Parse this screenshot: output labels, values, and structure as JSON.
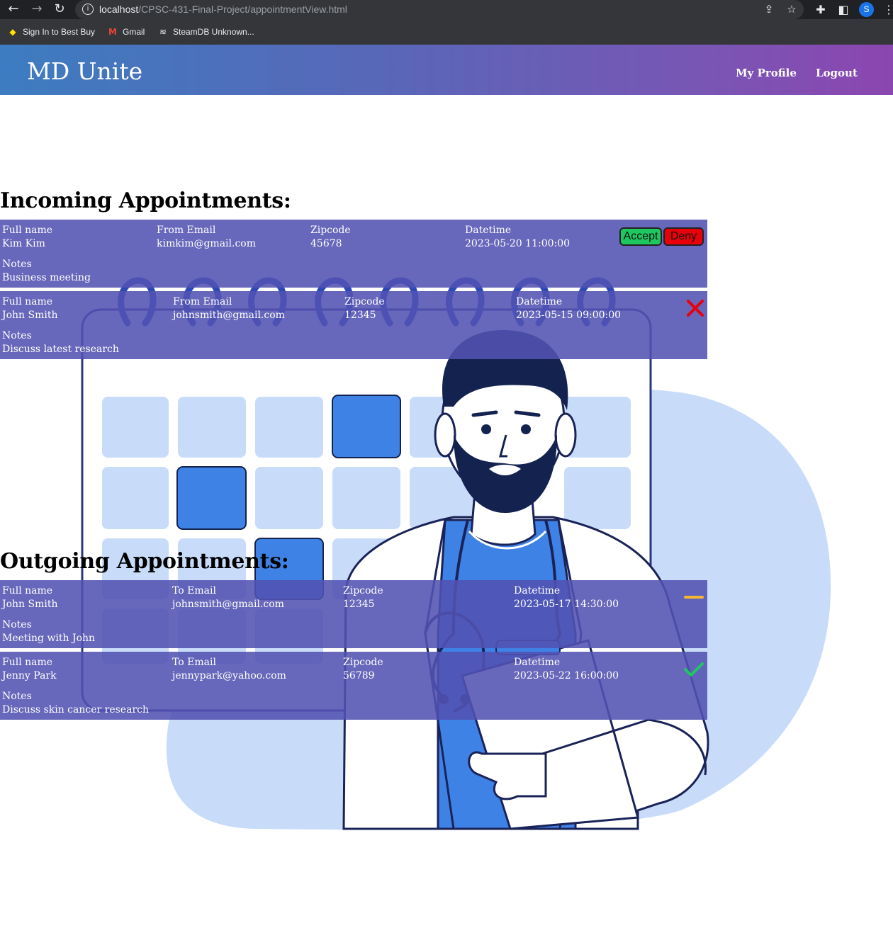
{
  "browser": {
    "url_host": "localhost",
    "url_path": "/CPSC-431-Final-Project/appointmentView.html",
    "profile_initial": "S",
    "bookmarks": [
      {
        "label": "Sign In to Best Buy",
        "icon": "tag-icon"
      },
      {
        "label": "Gmail",
        "icon": "gmail-icon"
      },
      {
        "label": "SteamDB Unknown...",
        "icon": "database-icon"
      }
    ]
  },
  "header": {
    "brand": "MD Unite",
    "nav": [
      {
        "label": "My Profile"
      },
      {
        "label": "Logout"
      }
    ]
  },
  "incoming": {
    "title": "Incoming Appointments:",
    "appointments": [
      {
        "labels": {
          "name": "Full name",
          "email": "From Email",
          "zip": "Zipcode",
          "datetime": "Datetime",
          "notes": "Notes"
        },
        "name": "Kim Kim",
        "email": "kimkim@gmail.com",
        "zip": "45678",
        "datetime": "2023-05-20 11:00:00",
        "notes": "Business meeting",
        "actions": {
          "accept": "Accept",
          "deny": "Deny"
        }
      },
      {
        "labels": {
          "name": "Full name",
          "email": "From Email",
          "zip": "Zipcode",
          "datetime": "Datetime",
          "notes": "Notes"
        },
        "name": "John Smith",
        "email": "johnsmith@gmail.com",
        "zip": "12345",
        "datetime": "2023-05-15 09:00:00",
        "notes": "Discuss latest research",
        "status": "denied",
        "status_color": "#e8000b"
      }
    ]
  },
  "outgoing": {
    "title": "Outgoing Appointments:",
    "appointments": [
      {
        "labels": {
          "name": "Full name",
          "email": "To Email",
          "zip": "Zipcode",
          "datetime": "Datetime",
          "notes": "Notes"
        },
        "name": "John Smith",
        "email": "johnsmith@gmail.com",
        "zip": "12345",
        "datetime": "2023-05-17 14:30:00",
        "notes": "Meeting with John",
        "status": "pending",
        "status_color": "#f5b731"
      },
      {
        "labels": {
          "name": "Full name",
          "email": "To Email",
          "zip": "Zipcode",
          "datetime": "Datetime",
          "notes": "Notes"
        },
        "name": "Jenny Park",
        "email": "jennypark@yahoo.com",
        "zip": "56789",
        "datetime": "2023-05-22 16:00:00",
        "notes": "Discuss skin cancer research",
        "status": "accepted",
        "status_color": "#1fc760"
      }
    ]
  },
  "colors": {
    "card_bg": "#5252b2",
    "accent_blue": "#3f82e6",
    "light_blue": "#c8dcfa",
    "navy": "#14224f"
  }
}
